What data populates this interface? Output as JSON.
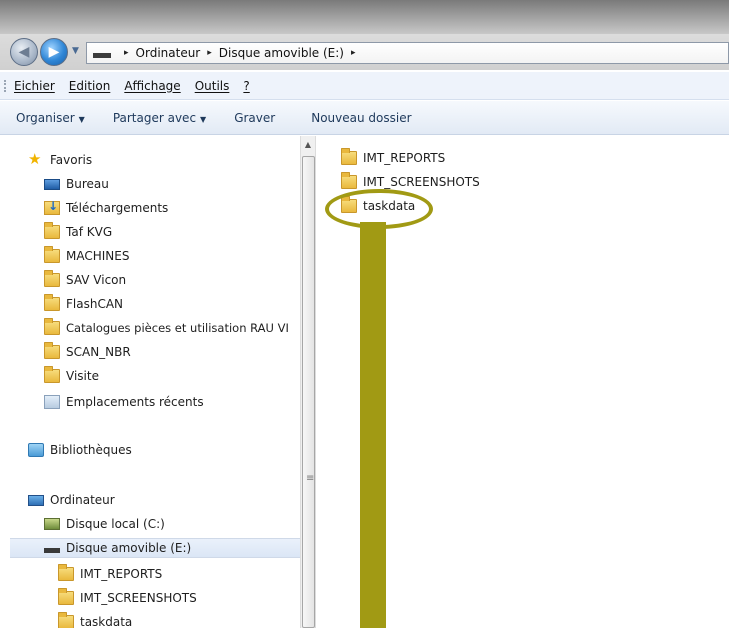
{
  "window": {
    "address_path": [
      "Ordinateur",
      "Disque amovible (E:)"
    ],
    "address_trailing_arrow": "▸"
  },
  "menu": [
    "Eichier",
    "Edition",
    "Affichage",
    "Outils",
    "?"
  ],
  "command_bar": {
    "organize": "Organiser",
    "share": "Partager avec",
    "burn": "Graver",
    "new_folder": "Nouveau dossier"
  },
  "nav_pane": {
    "favorites": {
      "header": "Favoris",
      "items": [
        {
          "label": "Bureau",
          "icon": "desktop-icon"
        },
        {
          "label": "Téléchargements",
          "icon": "downloads-icon"
        },
        {
          "label": "Taf KVG",
          "icon": "folder-icon"
        },
        {
          "label": "MACHINES",
          "icon": "folder-icon"
        },
        {
          "label": "SAV Vicon",
          "icon": "folder-icon"
        },
        {
          "label": "FlashCAN",
          "icon": "folder-icon"
        },
        {
          "label": "Catalogues pièces et utilisation RAU VI",
          "icon": "folder-icon"
        },
        {
          "label": "SCAN_NBR",
          "icon": "folder-icon"
        },
        {
          "label": "Visite",
          "icon": "folder-icon"
        },
        {
          "label": "Emplacements récents",
          "icon": "recent-places-icon"
        }
      ]
    },
    "libraries": "Bibliothèques",
    "computer": {
      "header": "Ordinateur",
      "local_disk": "Disque local (C:)",
      "removable": "Disque amovible (E:)",
      "children": [
        "IMT_REPORTS",
        "IMT_SCREENSHOTS",
        "taskdata"
      ]
    }
  },
  "content": {
    "folders": [
      "IMT_REPORTS",
      "IMT_SCREENSHOTS",
      "taskdata"
    ]
  },
  "colors": {
    "annotation": "#a19a14",
    "selected_bg": "#dbe6f5",
    "command_text": "#1e395b"
  }
}
